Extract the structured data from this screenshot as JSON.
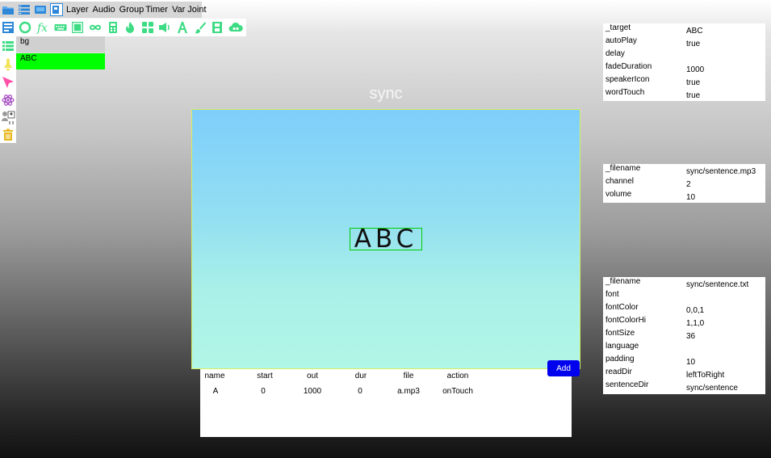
{
  "menu": {
    "items": [
      "Layer",
      "Audio",
      "Group",
      "Timer",
      "Var",
      "Joint"
    ]
  },
  "title_bar": "",
  "layers": {
    "items": [
      "bg",
      "ABC"
    ]
  },
  "stage": {
    "title": "sync",
    "sentence": "ABC"
  },
  "timing_table": {
    "columns": [
      "name",
      "start",
      "out",
      "dur",
      "file",
      "action"
    ],
    "rows": [
      [
        "A",
        "0",
        "1000",
        "0",
        "a.mp3",
        "onTouch"
      ]
    ],
    "add_label": "Add"
  },
  "props_target": [
    {
      "key": "_target",
      "value": "ABC"
    },
    {
      "key": "autoPlay",
      "value": "true"
    },
    {
      "key": "delay",
      "value": ""
    },
    {
      "key": "fadeDuration",
      "value": "1000"
    },
    {
      "key": "speakerIcon",
      "value": "true"
    },
    {
      "key": "wordTouch",
      "value": "true"
    }
  ],
  "props_audio": [
    {
      "key": "_filename",
      "value": "sync/sentence.mp3"
    },
    {
      "key": "channel",
      "value": "2"
    },
    {
      "key": "volume",
      "value": "10"
    }
  ],
  "props_text": [
    {
      "key": "_filename",
      "value": "sync/sentence.txt"
    },
    {
      "key": "font",
      "value": ""
    },
    {
      "key": "fontColor",
      "value": "0,0,1"
    },
    {
      "key": "fontColorHi",
      "value": "1,1,0"
    },
    {
      "key": "fontSize",
      "value": "36"
    },
    {
      "key": "language",
      "value": ""
    },
    {
      "key": "padding",
      "value": "10"
    },
    {
      "key": "readDir",
      "value": "leftToRight"
    },
    {
      "key": "sentenceDir",
      "value": "sync/sentence"
    }
  ],
  "icons": {
    "top": [
      "folder-icon",
      "layers-list-icon",
      "window-icon",
      "save-page-icon"
    ],
    "tools": [
      "page-icon",
      "circle-arrow-icon",
      "function-icon",
      "keyboard-icon",
      "rectangle-icon",
      "infinity-icon",
      "calculator-icon",
      "flame-icon",
      "grid-icon",
      "speaker-icon",
      "text-icon",
      "brush-icon",
      "film-icon",
      "cloud-icon"
    ],
    "left": [
      "list-icon",
      "bell-icon",
      "cursor-icon",
      "atom-icon",
      "people-icon",
      "trash-icon"
    ]
  },
  "colors": {
    "accent": "#3ddc84",
    "selected_layer": "#00ff00",
    "add_button": "#0000ee",
    "bounding_box": "#00cc00"
  }
}
